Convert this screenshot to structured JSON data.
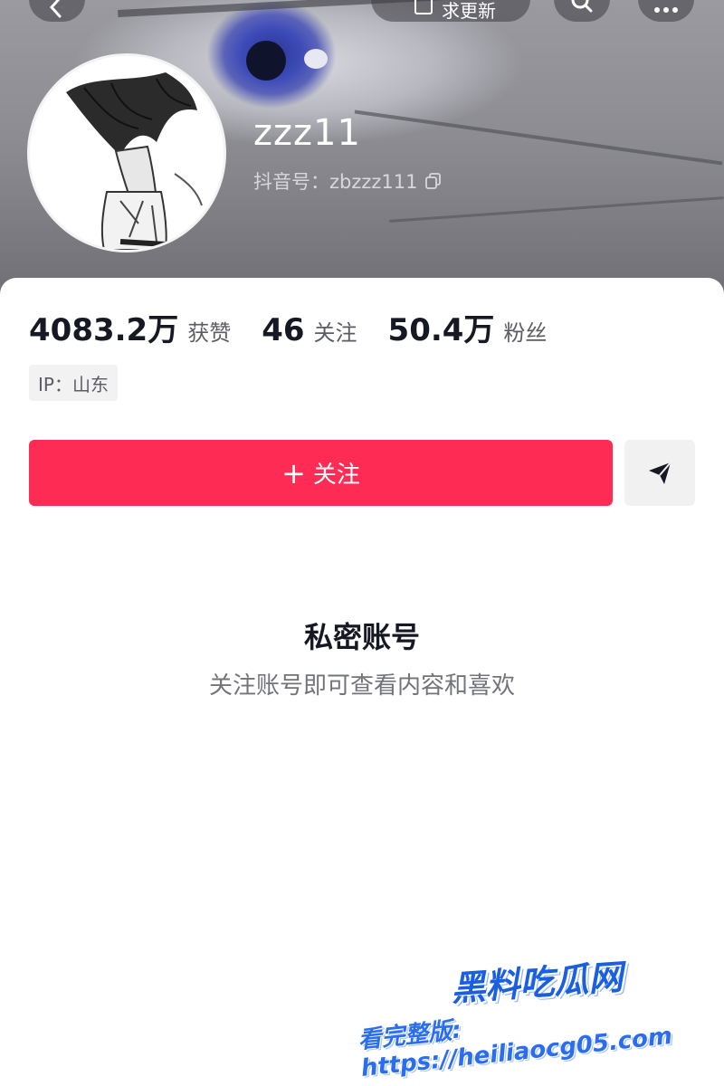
{
  "header": {
    "update_label": "求更新",
    "username": "zzz11",
    "douyin_id": "抖音号：zbzzz111"
  },
  "stats": [
    {
      "value": "4083.2万",
      "label": "获赞"
    },
    {
      "value": "46",
      "label": "关注"
    },
    {
      "value": "50.4万",
      "label": "粉丝"
    }
  ],
  "ip_tag": "IP：山东",
  "actions": {
    "follow_label": "关注",
    "follow_plus": "+"
  },
  "private": {
    "title": "私密账号",
    "subtitle": "关注账号即可查看内容和喜欢"
  },
  "watermark": {
    "brand": "黑料吃瓜网",
    "line": "看完整版: https://heiliaocg05.com"
  },
  "colors": {
    "accent": "#fe2c55",
    "text_primary": "#161823",
    "text_secondary": "#73747b"
  },
  "icons": [
    "back-icon",
    "search-icon",
    "more-icon",
    "copy-icon",
    "share-icon"
  ]
}
